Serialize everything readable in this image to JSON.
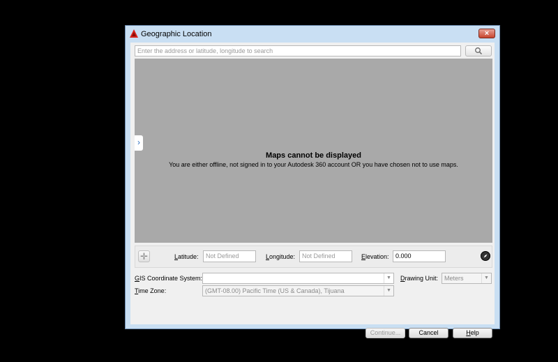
{
  "window": {
    "title": "Geographic Location",
    "close_label": "×"
  },
  "search": {
    "placeholder": "Enter the address or latitude, longitude to search"
  },
  "map": {
    "title": "Maps cannot be displayed",
    "message": "You are either offline, not signed in to your Autodesk 360 account OR you have chosen not to use maps.",
    "expand_label": "›"
  },
  "coords": {
    "latitude_label_u": "L",
    "latitude_label_rest": "atitude:",
    "latitude_value": "Not Defined",
    "longitude_label_u": "L",
    "longitude_label_rest": "ongitude:",
    "longitude_value": "Not Defined",
    "elevation_label_u": "E",
    "elevation_label_rest": "levation:",
    "elevation_value": "0.000"
  },
  "settings": {
    "gis_label_u": "G",
    "gis_label_rest": "IS Coordinate System:",
    "gis_value": "",
    "drawing_unit_label_u": "D",
    "drawing_unit_label_rest": "rawing Unit:",
    "drawing_unit_value": "Meters",
    "time_zone_label_u": "T",
    "time_zone_label_rest": "ime Zone:",
    "time_zone_value": "(GMT-08.00) Pacific Time (US & Canada), Tijuana"
  },
  "buttons": {
    "continue": "Continue...",
    "cancel": "Cancel",
    "help_u": "H",
    "help_rest": "elp"
  },
  "colors": {
    "accent": "#c7452e",
    "map_bg": "#a9a9a9"
  },
  "icons": {
    "app": "autocad-icon",
    "search": "search-icon",
    "pin": "crosshair-pin-icon",
    "compass": "compass-icon"
  }
}
